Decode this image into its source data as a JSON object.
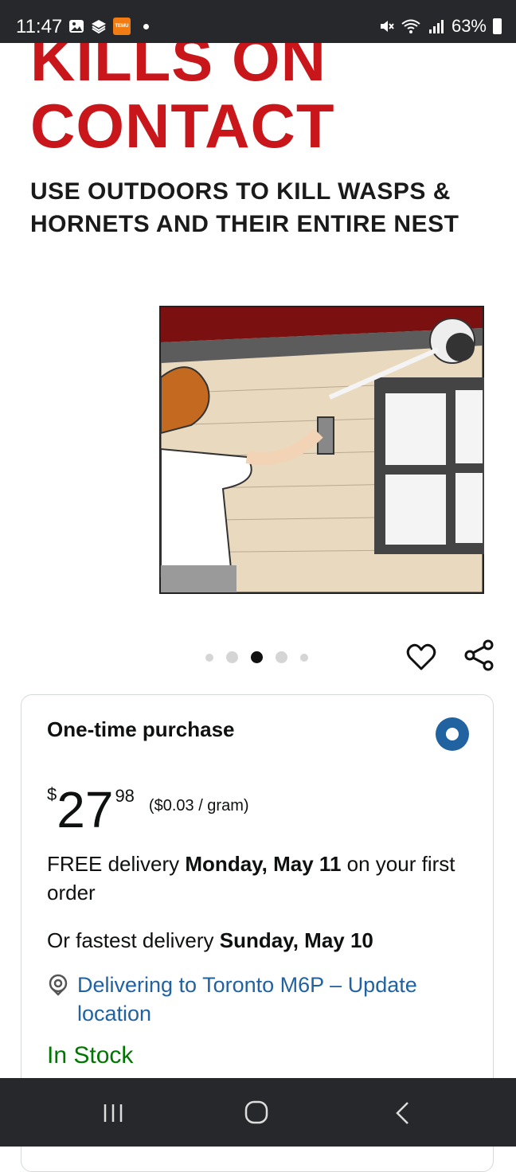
{
  "status_bar": {
    "time": "11:47",
    "battery": "63%",
    "temu_label": "TEMU"
  },
  "hero": {
    "headline_line1": "KILLS ON",
    "headline_line2": "CONTACT",
    "subtitle_line1": "USE OUTDOORS TO KILL WASPS &",
    "subtitle_line2": "HORNETS AND THEIR ENTIRE NEST"
  },
  "carousel": {
    "total_images": 5,
    "active_index": 2
  },
  "purchase": {
    "title": "One-time purchase",
    "price_symbol": "$",
    "price_whole": "27",
    "price_fraction": "98",
    "unit_price": "($0.03 / gram)",
    "delivery_prefix": "FREE delivery ",
    "delivery_date": "Monday, May 11",
    "delivery_suffix": " on your first order",
    "fastest_prefix": "Or fastest delivery ",
    "fastest_date": "Sunday, May 10",
    "location_text": "Delivering to Toronto M6P – Update location",
    "stock_status": "In Stock"
  },
  "colors": {
    "headline_red": "#c8161b",
    "link_blue": "#2162a1",
    "stock_green": "#007600",
    "system_bar": "#26282b"
  }
}
